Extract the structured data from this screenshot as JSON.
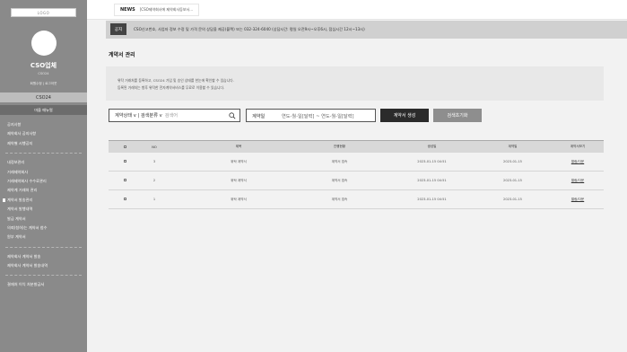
{
  "sidebar": {
    "logo_text": "LOGO",
    "org_name": "CSO업체",
    "org_code": "CSO24",
    "user_links": "회원수정 | 로그아웃",
    "primary_button": "CSO24",
    "secondary_button": "마을 매뉴얼",
    "menu_groups": [
      [
        "공지사항",
        "제약회사 공지사항",
        "제약별 시행공지"
      ],
      [
        "내정보관리",
        "거래제약회사",
        "거래제약회사 수수료관리",
        "제약계 거래처 관리",
        "계약서 발송관리",
        "계약서 발행내역",
        "발급 계약서",
        "의뢰(청하)는 계약서 첨수",
        "원부 계약서"
      ],
      [
        "제약회사 계약서 발송",
        "제약회사 계약서 발송내역"
      ],
      [
        "결재처 이익 처분발급서"
      ]
    ],
    "active_item": "계약서 발송관리"
  },
  "topbar": {
    "news_tag": "NEWS",
    "news_text": "[CSO제약회사에 제약회사등보서..."
  },
  "notice": {
    "tag": "공지",
    "text": "CSO신고번호, 사업자 정보 수정 및 가격 문의 상담을 제공(블랙) 또는 032-324-6040 (상담시간: 평일 오전9시~오후6시, 점심시간 12시~13시)"
  },
  "page": {
    "title": "계약서 관리",
    "info_lines": [
      "위탁 거래처를 등록하고, CSO24 가입 및 승인 상태를 한눈에 확인할 수 있습니다.",
      "등록된 거래처는 향후 위탁한 전자계약서비스를 무료로 이용할 수 있습니다."
    ]
  },
  "filters": {
    "status_label": "계약상태",
    "category_label": "검색분류",
    "search_placeholder": "검색어",
    "date_label": "계약일",
    "date_range": "연도-월-일[달력] ~ 연도-월-일[달력]",
    "create_button": "계약서 생성",
    "reset_button": "검색초기화"
  },
  "table": {
    "headers": [
      "",
      "NO",
      "제목",
      "진행현황",
      "생성일",
      "계약일",
      "계약서보기"
    ],
    "rows": [
      {
        "no": "3",
        "title": "위탁 계약서",
        "status": "계약서 접속",
        "created": "2023-01-15 04:51",
        "contract_date": "2023-01-15",
        "view": "열람/다운"
      },
      {
        "no": "2",
        "title": "위탁 계약서",
        "status": "계약서 접속",
        "created": "2023-01-15 04:51",
        "contract_date": "2023-01-15",
        "view": "열람/다운"
      },
      {
        "no": "1",
        "title": "위탁 계약서",
        "status": "계약서 접속",
        "created": "2023-01-15 04:51",
        "contract_date": "2023-01-15",
        "view": "열람/다운"
      }
    ]
  }
}
